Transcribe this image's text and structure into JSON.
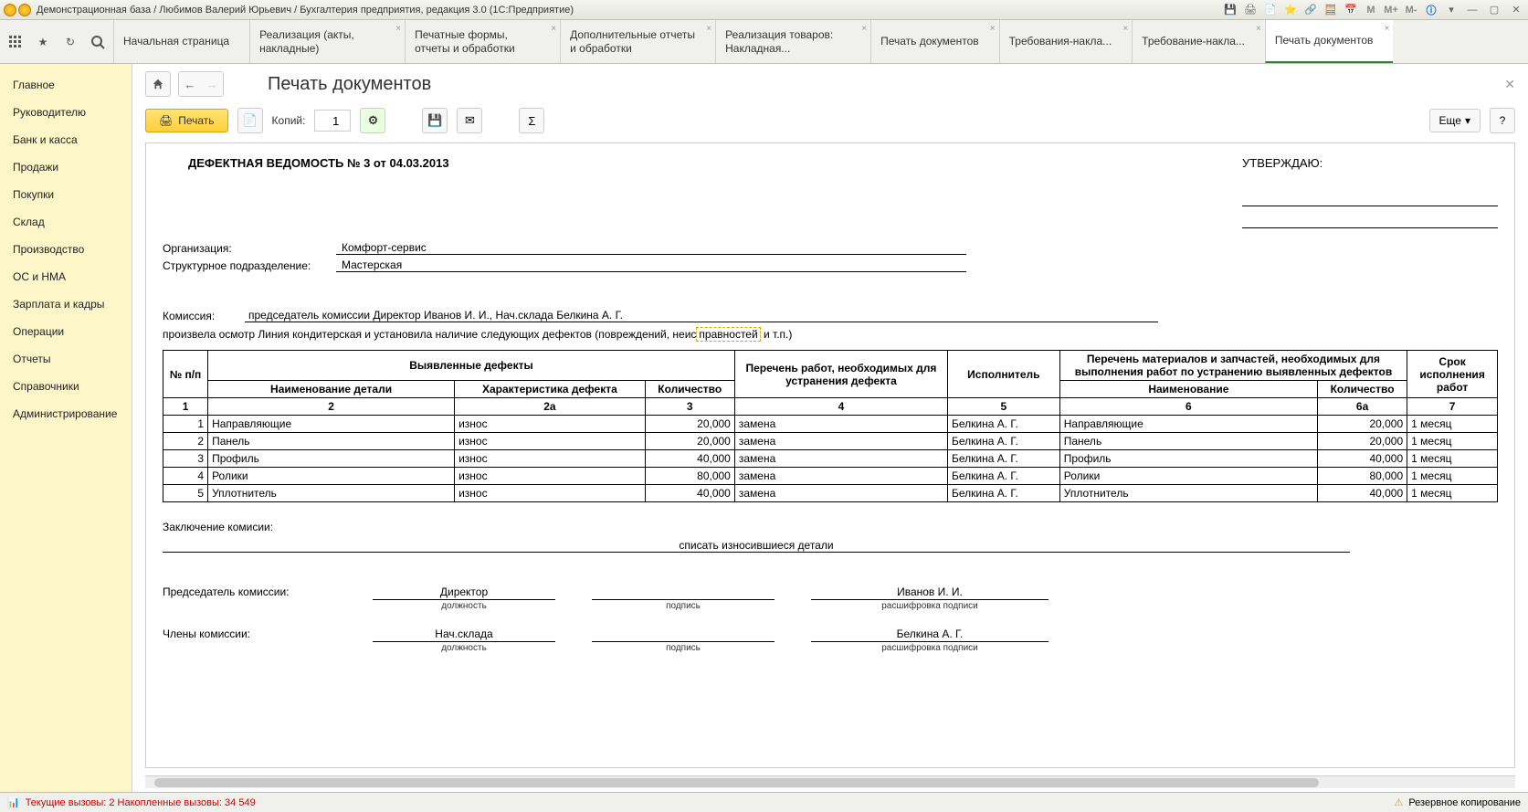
{
  "titlebar": {
    "text": "Демонстрационная база / Любимов Валерий Юрьевич / Бухгалтерия предприятия, редакция 3.0  (1С:Предприятие)",
    "mem_m": "M",
    "mem_mplus": "M+",
    "mem_mminus": "M-"
  },
  "tabs": [
    {
      "label": "Начальная страница",
      "closable": false
    },
    {
      "label": "Реализация (акты, накладные)",
      "closable": true
    },
    {
      "label": "Печатные формы, отчеты и обработки",
      "closable": true
    },
    {
      "label": "Дополнительные отчеты и обработки",
      "closable": true
    },
    {
      "label": "Реализация товаров: Накладная...",
      "closable": true
    },
    {
      "label": "Печать документов",
      "closable": true
    },
    {
      "label": "Требования-накла...",
      "closable": true
    },
    {
      "label": "Требование-накла...",
      "closable": true
    },
    {
      "label": "Печать документов",
      "closable": true,
      "active": true
    }
  ],
  "sidebar": [
    "Главное",
    "Руководителю",
    "Банк и касса",
    "Продажи",
    "Покупки",
    "Склад",
    "Производство",
    "ОС и НМА",
    "Зарплата и кадры",
    "Операции",
    "Отчеты",
    "Справочники",
    "Администрирование"
  ],
  "page": {
    "title": "Печать документов",
    "toolbar": {
      "print": "Печать",
      "copies_label": "Копий:",
      "copies_value": "1",
      "more": "Еще"
    }
  },
  "doc": {
    "title": "ДЕФЕКТНАЯ ВЕДОМОСТЬ № 3 от 04.03.2013",
    "approve": "УТВЕРЖДАЮ:",
    "org_label": "Организация:",
    "org_value": "Комфорт-сервис",
    "dept_label": "Структурное подразделение:",
    "dept_value": "Мастерская",
    "komissia_label": "Комиссия:",
    "komissia_value": "председатель комиссии Директор Иванов И. И., Нач.склада Белкина А. Г.",
    "inspect_pre": "произвела осмотр Линия кондитерская и установила наличие следующих дефектов (повреждений, неис",
    "inspect_hl": "правностей",
    "inspect_post": " и т.п.)",
    "table": {
      "headers": {
        "num": "№ п/п",
        "defects": "Выявленные дефекты",
        "part": "Наименование детали",
        "char": "Характеристика дефекта",
        "qty": "Количество",
        "works": "Перечень работ, необходимых для устранения дефекта",
        "exec": "Исполнитель",
        "materials": "Перечень материалов и запчастей, необходимых для выполнения работ по устранению выявленных дефектов",
        "mat_name": "Наименование",
        "mat_qty": "Количество",
        "deadline": "Срок исполнения работ"
      },
      "subhead": [
        "1",
        "2",
        "2а",
        "3",
        "4",
        "5",
        "6",
        "6а",
        "7"
      ],
      "rows": [
        {
          "n": "1",
          "part": "Направляющие",
          "char": "износ",
          "qty": "20,000",
          "work": "замена",
          "exec": "Белкина А. Г.",
          "mname": "Направляющие",
          "mqty": "20,000",
          "due": "1 месяц"
        },
        {
          "n": "2",
          "part": "Панель",
          "char": "износ",
          "qty": "20,000",
          "work": "замена",
          "exec": "Белкина А. Г.",
          "mname": "Панель",
          "mqty": "20,000",
          "due": "1 месяц"
        },
        {
          "n": "3",
          "part": "Профиль",
          "char": "износ",
          "qty": "40,000",
          "work": "замена",
          "exec": "Белкина А. Г.",
          "mname": "Профиль",
          "mqty": "40,000",
          "due": "1 месяц"
        },
        {
          "n": "4",
          "part": "Ролики",
          "char": "износ",
          "qty": "80,000",
          "work": "замена",
          "exec": "Белкина А. Г.",
          "mname": "Ролики",
          "mqty": "80,000",
          "due": "1 месяц"
        },
        {
          "n": "5",
          "part": "Уплотнитель",
          "char": "износ",
          "qty": "40,000",
          "work": "замена",
          "exec": "Белкина А. Г.",
          "mname": "Уплотнитель",
          "mqty": "40,000",
          "due": "1 месяц"
        }
      ]
    },
    "conclusion_label": "Заключение комисии:",
    "conclusion_value": "списать износившиеся детали",
    "chairman_label": "Председатель комиссии:",
    "chairman_pos": "Директор",
    "chairman_name": "Иванов И. И.",
    "members_label": "Члены комиссии:",
    "member_pos": "Нач.склада",
    "member_name": "Белкина А. Г.",
    "sig_pos": "должность",
    "sig_sign": "подпись",
    "sig_name": "расшифровка подписи"
  },
  "statusbar": {
    "perf": "Текущие вызовы: 2  Накопленные вызовы: 34 549",
    "backup": "Резервное копирование"
  }
}
